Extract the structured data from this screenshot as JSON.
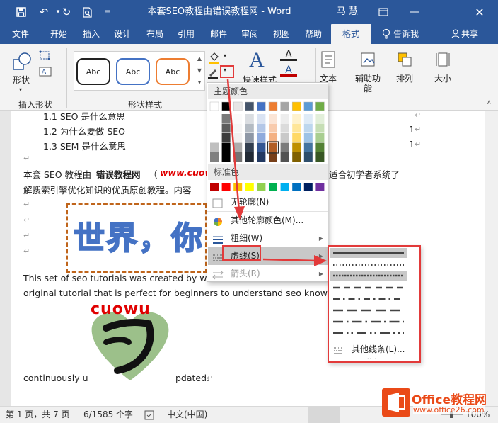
{
  "titlebar": {
    "title": "本套SEO教程由错误教程网  -  Word",
    "user": "马 慧"
  },
  "tabs": [
    "文件",
    "开始",
    "插入",
    "设计",
    "布局",
    "引用",
    "邮件",
    "审阅",
    "视图",
    "帮助",
    "格式",
    "告诉我",
    "共享"
  ],
  "ribbon": {
    "shape_label": "形状",
    "insert_shapes_group": "插入形状",
    "abc": "Abc",
    "shape_styles_group": "形状样式",
    "quick_styles": "快速样式",
    "text_label": "文本",
    "accessibility_label": "辅助功",
    "accessibility_label2": "能",
    "arrange_label": "排列",
    "size_label": "大小"
  },
  "document": {
    "toc": [
      {
        "text": "1.1 SEO 是什么意思",
        "page": "1"
      },
      {
        "text": "1.2  为什么要做 SEO",
        "page": "1"
      },
      {
        "text": "1.3 SEM 是什么意思",
        "page": "1"
      }
    ],
    "para1_a": "本套 SEO 教程由",
    "para1_bold": "错误教程网",
    "para1_b": "（",
    "para1_red": "www.cuow",
    "para1_c": "适合初学者系统了",
    "para2": "解搜索引擎优化知识的优质原创教程。内容",
    "wordart": "世界，你",
    "eng1": "This set of seo tutorials was created by wro",
    "eng2": "original tutorial that is perfect for beginners to understand seo knowled",
    "heart_text": "cuowu",
    "eng3_a": "continuously u",
    "eng3_b": "pdated."
  },
  "dropdown": {
    "theme_colors": "主题颜色",
    "standard_colors": "标准色",
    "no_outline": "无轮廓(N)",
    "more_colors": "其他轮廓颜色(M)...",
    "weight": "粗细(W)",
    "dashes": "虚线(S)",
    "arrows": "箭头(R)"
  },
  "submenu": {
    "more_lines": "其他线条(L)..."
  },
  "status": {
    "page": "第 1 页，共 7 页",
    "words": "6/1585 个字",
    "language": "中文(中国)",
    "zoom": "100%"
  },
  "watermark": {
    "brand": "Office教程网",
    "url": "www.office26.com"
  },
  "colors": {
    "brand_blue": "#2b579a",
    "highlight_red": "#e23a3a",
    "theme_row": [
      "#ffffff",
      "#000000",
      "#e7e6e6",
      "#44546a",
      "#4472c4",
      "#ed7d31",
      "#a5a5a5",
      "#ffc000",
      "#5b9bd5",
      "#70ad47"
    ],
    "standard_row": [
      "#c00000",
      "#ff0000",
      "#ffc000",
      "#ffff00",
      "#92d050",
      "#00b050",
      "#00b0f0",
      "#0070c0",
      "#002060",
      "#7030a0"
    ]
  }
}
